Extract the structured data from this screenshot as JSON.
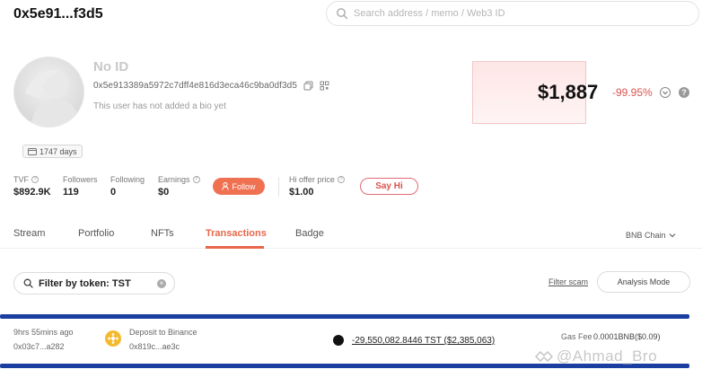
{
  "header": {
    "short_address": "0x5e91...f3d5",
    "search_placeholder": "Search address / memo / Web3 ID"
  },
  "profile": {
    "name": "No ID",
    "full_address": "0x5e913389a5972c7dff4e816d3eca46c9ba0df3d5",
    "bio": "This user has not added a bio yet",
    "days": "1747 days"
  },
  "pnl": {
    "value": "$1,887",
    "change": "-99.95%",
    "help": "?"
  },
  "stats": {
    "tvf_label": "TVF",
    "tvf_value": "$892.9K",
    "followers_label": "Followers",
    "followers_value": "119",
    "following_label": "Following",
    "following_value": "0",
    "earnings_label": "Earnings",
    "earnings_value": "$0",
    "follow_label": "Follow",
    "hi_offer_label": "Hi offer price",
    "hi_offer_value": "$1.00",
    "say_hi_label": "Say Hi"
  },
  "tabs": [
    {
      "label": "Stream"
    },
    {
      "label": "Portfolio"
    },
    {
      "label": "NFTs"
    },
    {
      "label": "Transactions"
    },
    {
      "label": "Badge"
    }
  ],
  "active_tab": "Transactions",
  "chain_select": "BNB Chain",
  "filters": {
    "token_filter": "Filter by token: TST",
    "filter_scam": "Filter scam",
    "analysis_mode": "Analysis Mode"
  },
  "transactions": [
    {
      "time": "9hrs 55mins ago",
      "from": "0x03c7...a282",
      "type": "Deposit to Binance",
      "to": "0x819c...ae3c",
      "amount": "-29,550,082.8446 TST ($2,385,063)",
      "gas_label": "Gas Fee",
      "gas_value": "0.0001BNB($0.09)"
    }
  ],
  "watermark": "@Ahmad_Bro",
  "colors": {
    "accent": "#e8674a",
    "negative": "#d9534f",
    "highlight_line": "#1a3fa0",
    "bnb": "#f3ba2f"
  }
}
